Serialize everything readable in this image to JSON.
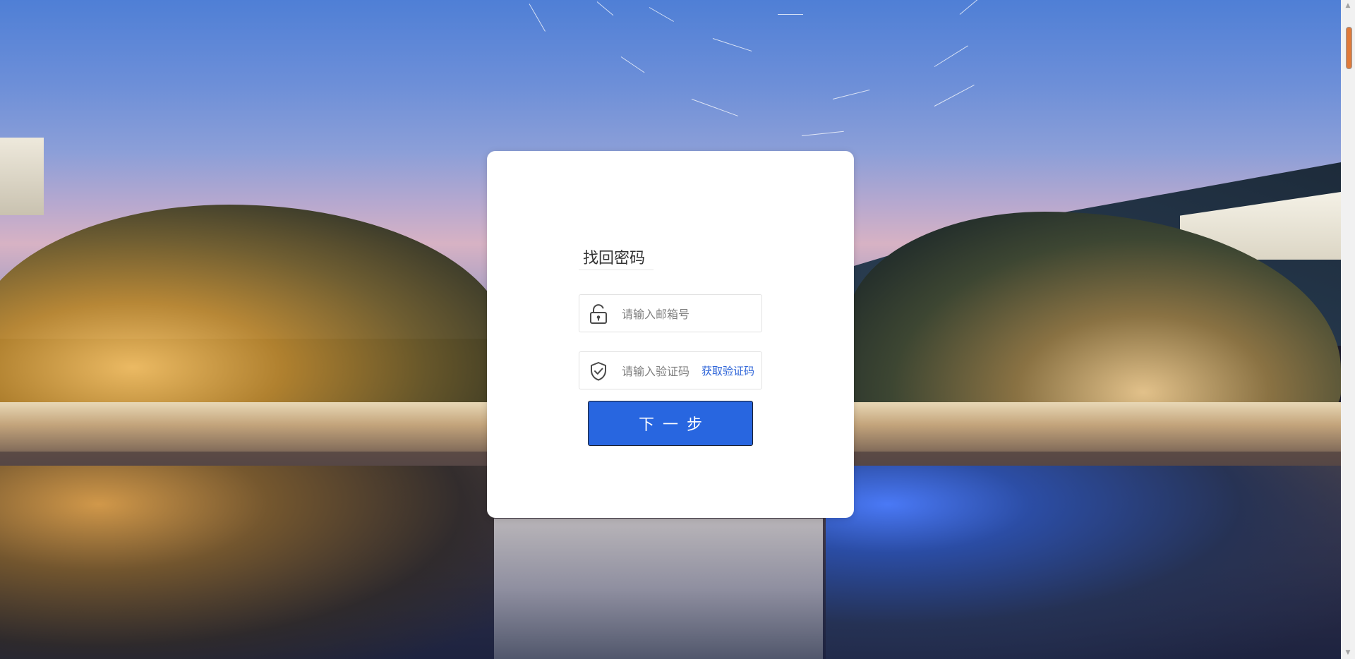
{
  "form": {
    "title": "找回密码",
    "email_placeholder": "请输入邮箱号",
    "code_placeholder": "请输入验证码",
    "get_code_label": "获取验证码",
    "next_label": "下一步"
  },
  "colors": {
    "primary_button": "#2866e0",
    "link": "#2d64d8",
    "card_background": "#ffffff"
  },
  "icons": {
    "email_field": "unlock-icon",
    "code_field": "shield-check-icon"
  }
}
